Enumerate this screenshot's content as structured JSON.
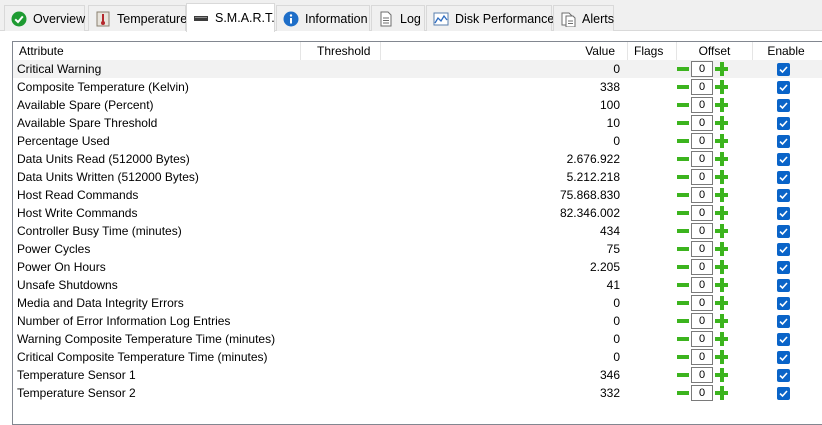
{
  "tabs": [
    {
      "id": "overview",
      "label": "Overview",
      "icon": "check-circle-icon",
      "active": false
    },
    {
      "id": "temperature",
      "label": "Temperature",
      "icon": "thermometer-icon",
      "active": false
    },
    {
      "id": "smart",
      "label": "S.M.A.R.T.",
      "icon": "drive-icon",
      "active": true
    },
    {
      "id": "information",
      "label": "Information",
      "icon": "info-icon",
      "active": false
    },
    {
      "id": "log",
      "label": "Log",
      "icon": "document-icon",
      "active": false
    },
    {
      "id": "disk_performance",
      "label": "Disk Performance",
      "icon": "chart-icon",
      "active": false
    },
    {
      "id": "alerts",
      "label": "Alerts",
      "icon": "alerts-icon",
      "active": false
    }
  ],
  "table": {
    "headers": {
      "attribute": "Attribute",
      "threshold": "Threshold",
      "value": "Value",
      "flags": "Flags",
      "offset": "Offset",
      "enable": "Enable"
    },
    "rows": [
      {
        "attribute": "Critical Warning",
        "value": "0",
        "offset": "0",
        "enabled": true
      },
      {
        "attribute": "Composite Temperature (Kelvin)",
        "value": "338",
        "offset": "0",
        "enabled": true
      },
      {
        "attribute": "Available Spare (Percent)",
        "value": "100",
        "offset": "0",
        "enabled": true
      },
      {
        "attribute": "Available Spare Threshold",
        "value": "10",
        "offset": "0",
        "enabled": true
      },
      {
        "attribute": "Percentage Used",
        "value": "0",
        "offset": "0",
        "enabled": true
      },
      {
        "attribute": "Data Units Read (512000 Bytes)",
        "value": "2.676.922",
        "offset": "0",
        "enabled": true
      },
      {
        "attribute": "Data Units Written (512000 Bytes)",
        "value": "5.212.218",
        "offset": "0",
        "enabled": true
      },
      {
        "attribute": "Host Read Commands",
        "value": "75.868.830",
        "offset": "0",
        "enabled": true
      },
      {
        "attribute": "Host Write Commands",
        "value": "82.346.002",
        "offset": "0",
        "enabled": true
      },
      {
        "attribute": "Controller Busy Time (minutes)",
        "value": "434",
        "offset": "0",
        "enabled": true
      },
      {
        "attribute": "Power Cycles",
        "value": "75",
        "offset": "0",
        "enabled": true
      },
      {
        "attribute": "Power On Hours",
        "value": "2.205",
        "offset": "0",
        "enabled": true
      },
      {
        "attribute": "Unsafe Shutdowns",
        "value": "41",
        "offset": "0",
        "enabled": true
      },
      {
        "attribute": "Media and Data Integrity Errors",
        "value": "0",
        "offset": "0",
        "enabled": true
      },
      {
        "attribute": "Number of Error Information Log Entries",
        "value": "0",
        "offset": "0",
        "enabled": true
      },
      {
        "attribute": "Warning Composite Temperature Time (minutes)",
        "value": "0",
        "offset": "0",
        "enabled": true
      },
      {
        "attribute": "Critical Composite Temperature Time (minutes)",
        "value": "0",
        "offset": "0",
        "enabled": true
      },
      {
        "attribute": "Temperature Sensor 1",
        "value": "346",
        "offset": "0",
        "enabled": true
      },
      {
        "attribute": "Temperature Sensor 2",
        "value": "332",
        "offset": "0",
        "enabled": true
      }
    ]
  },
  "colors": {
    "checkbox_blue": "#0a64c8",
    "stepper_green": "#3cb41e",
    "overview_green": "#1e9b32",
    "info_blue": "#1e6ec8"
  }
}
